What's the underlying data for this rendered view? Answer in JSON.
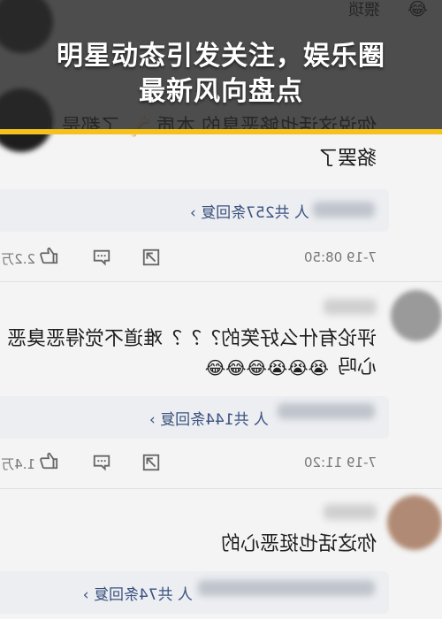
{
  "banner": {
    "title_line1": "明星动态引发关注，娱乐圈",
    "title_line2": "最新风向盘点",
    "accent_color": "#f5c21b"
  },
  "comments": [
    {
      "top_fragment": "猥琐",
      "text_line1": "你说这话也够恶臭的 本质",
      "text_line1_tail": "了都是 丘之",
      "text_line2": "貉罢了",
      "reply_summary": "共257条回复",
      "reply_prefix": "人",
      "timestamp": "7-19 08:50",
      "like_count": "2.2万"
    },
    {
      "text_line1": "评论有什么好笑的？？？难道不觉得恶臭恶",
      "text_line2": "心吗",
      "emoji": "😭😭😭😂😂😂",
      "reply_summary": "共144条回复",
      "reply_prefix": "人",
      "timestamp": "7-19 11:20",
      "like_count": "1.4万"
    },
    {
      "text_line1": "你这话也挺恶心的",
      "reply_summary": "共74条回复",
      "reply_prefix": "人"
    }
  ],
  "icons": {
    "like": "thumbs-up-icon",
    "comment": "comment-bubble-icon",
    "share": "share-icon",
    "chevron": "chevron-icon"
  }
}
